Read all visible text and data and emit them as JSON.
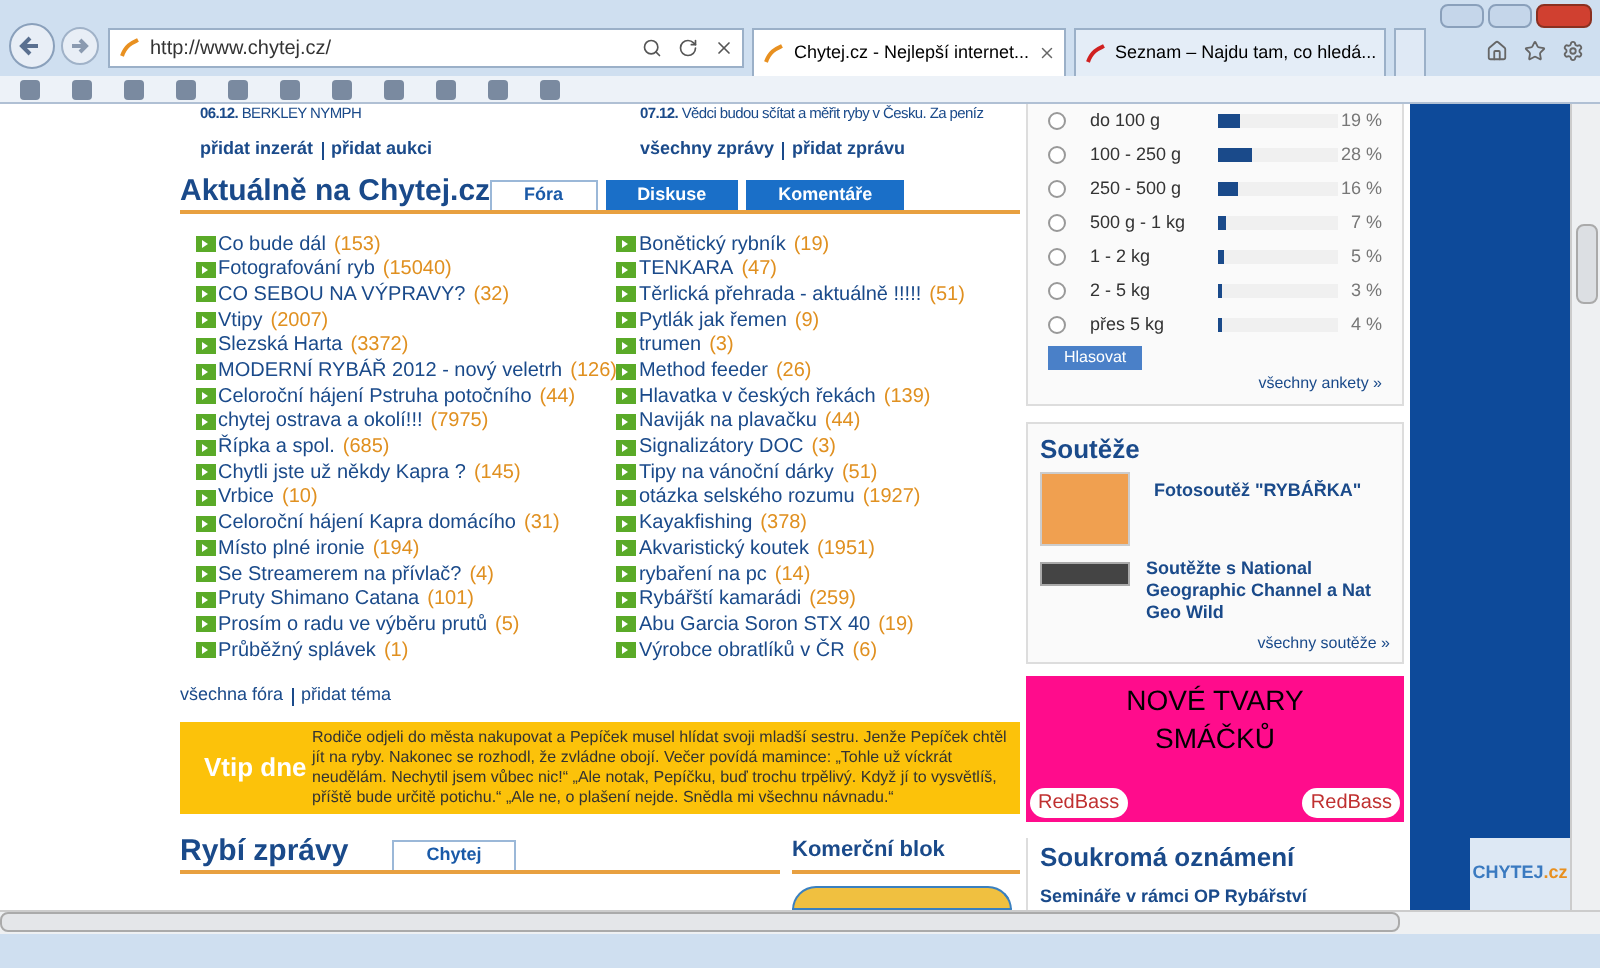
{
  "browser": {
    "address": "http://www.chytej.cz/",
    "tabs": [
      {
        "title": "Chytej.cz - Nejlepší internet...",
        "selected": true
      },
      {
        "title": "Seznam – Najdu tam, co hledá...",
        "selected": false
      }
    ]
  },
  "news_top": [
    {
      "date": "06.12.",
      "text": "BERKLEY NYMPH",
      "links": [
        "přidat inzerát",
        "přidat aukci"
      ]
    },
    {
      "date": "07.12.",
      "text": "Vědci budou sčítat a měřit ryby v Česku. Za peníz",
      "links": [
        "všechny zprávy",
        "přidat zprávu"
      ]
    }
  ],
  "aktualne": {
    "title": "Aktuálně na Chytej.cz",
    "tabs": [
      {
        "label": "Fóra",
        "selected": true
      },
      {
        "label": "Diskuse",
        "selected": false
      },
      {
        "label": "Komentáře",
        "selected": false
      }
    ],
    "columns": [
      [
        {
          "title": "Co bude dál",
          "count": "(153)"
        },
        {
          "title": "Fotografování ryb",
          "count": "(15040)"
        },
        {
          "title": "CO SEBOU NA VÝPRAVY?",
          "count": "(32)"
        },
        {
          "title": "Vtipy",
          "count": "(2007)"
        },
        {
          "title": "Slezská Harta",
          "count": "(3372)"
        },
        {
          "title": "MODERNÍ RYBÁŘ 2012 - nový veletrh",
          "count": "(126)"
        },
        {
          "title": "Celoroční hájení Pstruha potočního",
          "count": "(44)"
        },
        {
          "title": "chytej ostrava a okolí!!!",
          "count": "(7975)"
        },
        {
          "title": "Řípka a spol.",
          "count": "(685)"
        },
        {
          "title": "Chytli jste už někdy Kapra ?",
          "count": "(145)"
        },
        {
          "title": "Vrbice",
          "count": "(10)"
        },
        {
          "title": "Celoroční hájení Kapra domácího",
          "count": "(31)"
        },
        {
          "title": "Místo plné ironie",
          "count": "(194)"
        },
        {
          "title": "Se Streamerem na přívlač?",
          "count": "(4)"
        },
        {
          "title": "Pruty Shimano Catana",
          "count": "(101)"
        },
        {
          "title": "Prosím o radu ve výběru prutů",
          "count": "(5)"
        },
        {
          "title": "Průběžný splávek",
          "count": "(1)"
        }
      ],
      [
        {
          "title": "Bonětický rybník",
          "count": "(19)"
        },
        {
          "title": "TENKARA",
          "count": "(47)"
        },
        {
          "title": "Těrlická přehrada - aktuálně !!!!!",
          "count": "(51)"
        },
        {
          "title": "Pytlák jak řemen",
          "count": "(9)"
        },
        {
          "title": "trumen",
          "count": "(3)"
        },
        {
          "title": "Method feeder",
          "count": "(26)"
        },
        {
          "title": "Hlavatka v českých řekách",
          "count": "(139)"
        },
        {
          "title": "Naviják na plavačku",
          "count": "(44)"
        },
        {
          "title": "Signalizátory DOC",
          "count": "(3)"
        },
        {
          "title": "Tipy na vánoční dárky",
          "count": "(51)"
        },
        {
          "title": "otázka selského rozumu",
          "count": "(1927)"
        },
        {
          "title": "Kayakfishing",
          "count": "(378)"
        },
        {
          "title": "Akvaristický koutek",
          "count": "(1951)"
        },
        {
          "title": "rybaření na pc",
          "count": "(14)"
        },
        {
          "title": "Rybářští kamarádi",
          "count": "(259)"
        },
        {
          "title": "Abu Garcia Soron STX 40",
          "count": "(19)"
        },
        {
          "title": "Výrobce obratlíků v ČR",
          "count": "(6)"
        }
      ]
    ],
    "links": [
      "všechna fóra",
      "přidat téma"
    ]
  },
  "joke": {
    "label": "Vtip dne",
    "text": "Rodiče odjeli do města nakupovat a Pepíček musel hlídat svoji mladší sestru. Jenže Pepíček chtěl jít na ryby. Nakonec se rozhodl, že zvládne obojí. Večer povídá mamince: „Tohle už víckrát neudělám. Nechytil jsem vůbec nic!“ „Ale notak, Pepíčku, buď trochu trpělivý. Když jí to vysvětlíš, příště bude určitě potichu.“ „Ale ne, o plašení nejde. Snědla mi všechnu návnadu.“"
  },
  "rybi_zpravy": {
    "title": "Rybí zprávy",
    "tabs": [
      {
        "label": "Chytej",
        "selected": true
      }
    ]
  },
  "komercni_blok": {
    "title": "Komerční blok"
  },
  "poll": {
    "options": [
      {
        "label": "do 100 g",
        "selected": false,
        "level": 0.19,
        "reading": "19 %"
      },
      {
        "label": "100 - 250 g",
        "selected": false,
        "level": 0.28,
        "reading": "28 %"
      },
      {
        "label": "250 - 500 g",
        "selected": false,
        "level": 0.16,
        "reading": "16 %"
      },
      {
        "label": "500 g - 1 kg",
        "selected": false,
        "level": 0.07,
        "reading": "7 %"
      },
      {
        "label": "1 - 2 kg",
        "selected": false,
        "level": 0.05,
        "reading": "5 %"
      },
      {
        "label": "2 - 5 kg",
        "selected": false,
        "level": 0.03,
        "reading": "3 %"
      },
      {
        "label": "přes 5 kg",
        "selected": false,
        "level": 0.04,
        "reading": "4 %"
      }
    ],
    "button": "Hlasovat",
    "more": "všechny ankety »"
  },
  "souteze": {
    "title": "Soutěže",
    "items": [
      "Fotosoutěž \"RYBÁŘKA\"",
      "Soutěžte s National Geographic Channel a Nat Geo Wild"
    ],
    "more": "všechny soutěže »"
  },
  "ad": {
    "lines": [
      "NOVÉ TVARY",
      "SMÁČKŮ"
    ],
    "brands": [
      "RedBass",
      "RedBass"
    ]
  },
  "oznameni": {
    "title": "Soukromá oznámení",
    "items": [
      "Semináře v rámci OP Rybářství"
    ]
  },
  "floating_logo": {
    "text": "CHYTEJ",
    "suffix": ".cz"
  }
}
